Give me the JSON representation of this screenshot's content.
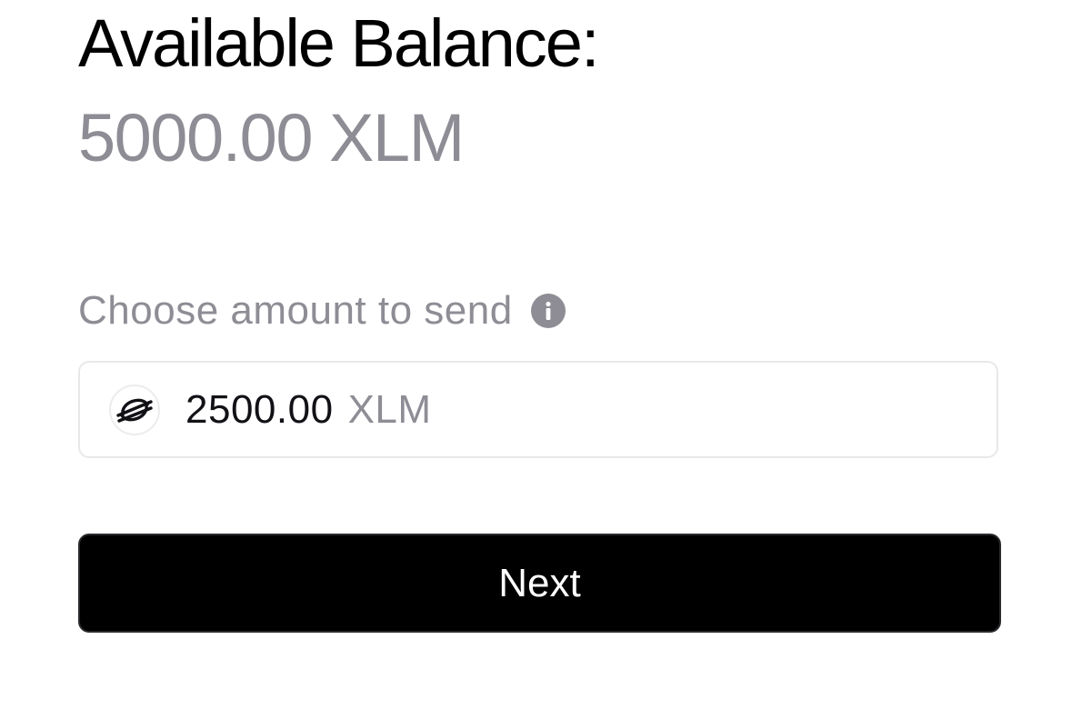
{
  "balance": {
    "title": "Available Balance:",
    "amount": "5000.00 XLM"
  },
  "send": {
    "label": "Choose amount to send",
    "info_icon": "info-icon",
    "asset_icon": "stellar-logo-icon",
    "amount_value": "2500.00",
    "amount_unit": "XLM"
  },
  "actions": {
    "next_label": "Next"
  },
  "colors": {
    "primary_text": "#000000",
    "muted_text": "#8e8d95",
    "button_bg": "#000000",
    "button_text": "#ffffff",
    "input_border": "#e8e8ea"
  }
}
